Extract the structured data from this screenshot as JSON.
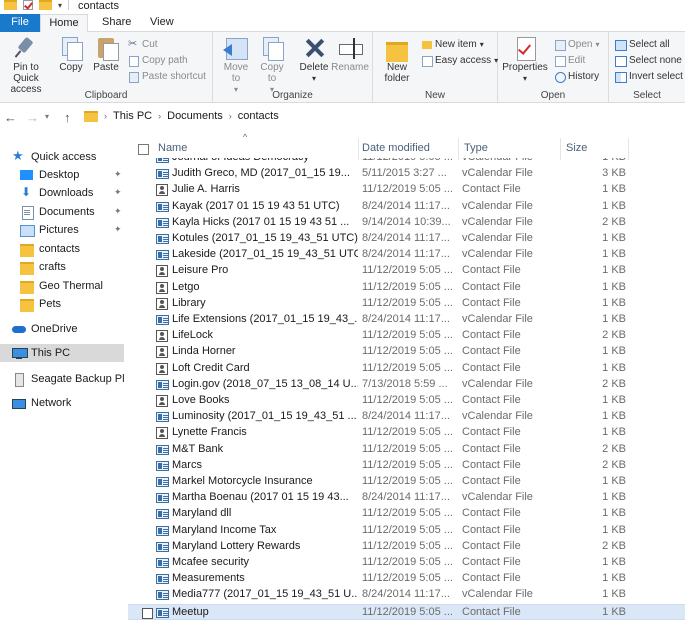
{
  "window": {
    "title": "contacts"
  },
  "tabs": {
    "file": "File",
    "home": "Home",
    "share": "Share",
    "view": "View"
  },
  "ribbon": {
    "clipboard": {
      "label": "Clipboard",
      "pin": "Pin to Quick access",
      "copy": "Copy",
      "paste": "Paste",
      "cut": "Cut",
      "copy_path": "Copy path",
      "paste_shortcut": "Paste shortcut"
    },
    "organize": {
      "label": "Organize",
      "move_to": "Move to",
      "copy_to": "Copy to",
      "delete": "Delete",
      "rename": "Rename"
    },
    "new": {
      "label": "New",
      "new_folder": "New folder",
      "new_item": "New item",
      "easy_access": "Easy access"
    },
    "open": {
      "label": "Open",
      "properties": "Properties",
      "open": "Open",
      "edit": "Edit",
      "history": "History"
    },
    "select": {
      "label": "Select",
      "select_all": "Select all",
      "select_none": "Select none",
      "invert": "Invert select"
    }
  },
  "address": {
    "crumbs": [
      "This PC",
      "Documents",
      "contacts"
    ]
  },
  "nav": {
    "items": [
      {
        "label": "Quick access",
        "icon": "star-icon",
        "pinned": false
      },
      {
        "label": "Desktop",
        "icon": "desktop-icon",
        "pinned": true
      },
      {
        "label": "Downloads",
        "icon": "download-icon",
        "pinned": true
      },
      {
        "label": "Documents",
        "icon": "documents-icon",
        "pinned": true
      },
      {
        "label": "Pictures",
        "icon": "pictures-icon",
        "pinned": true
      },
      {
        "label": "contacts",
        "icon": "folder-icon",
        "pinned": false
      },
      {
        "label": "crafts",
        "icon": "folder-icon",
        "pinned": false
      },
      {
        "label": "Geo Thermal",
        "icon": "folder-icon",
        "pinned": false
      },
      {
        "label": "Pets",
        "icon": "folder-icon",
        "pinned": false
      },
      {
        "label": "OneDrive",
        "icon": "onedrive-icon",
        "pinned": false
      },
      {
        "label": "This PC",
        "icon": "this-pc-icon",
        "pinned": false
      },
      {
        "label": "Seagate Backup Plu",
        "icon": "drive-icon",
        "pinned": false
      },
      {
        "label": "Network",
        "icon": "network-icon",
        "pinned": false
      }
    ],
    "pin_glyph": "✦"
  },
  "columns": {
    "name": "Name",
    "date": "Date modified",
    "type": "Type",
    "size": "Size"
  },
  "files": [
    {
      "name": "Journal of Ideas Democracy",
      "date": "11/12/2019 5:05 ...",
      "type": "vCalendar File",
      "size": "1 KB",
      "icon": "vcard"
    },
    {
      "name": "Judith Greco, MD (2017_01_15 19...",
      "date": "5/11/2015 3:27 ...",
      "type": "vCalendar File",
      "size": "3 KB",
      "icon": "vcard"
    },
    {
      "name": "Julie A. Harris",
      "date": "11/12/2019 5:05 ...",
      "type": "Contact File",
      "size": "1 KB",
      "icon": "contact"
    },
    {
      "name": "Kayak (2017 01 15 19 43 51 UTC)",
      "date": "8/24/2014 11:17...",
      "type": "vCalendar File",
      "size": "1 KB",
      "icon": "vcard"
    },
    {
      "name": "Kayla Hicks (2017 01 15 19 43 51 ...",
      "date": "9/14/2014 10:39...",
      "type": "vCalendar File",
      "size": "2 KB",
      "icon": "vcard"
    },
    {
      "name": "Kotules (2017_01_15 19_43_51 UTC)",
      "date": "8/24/2014 11:17...",
      "type": "vCalendar File",
      "size": "1 KB",
      "icon": "vcard"
    },
    {
      "name": "Lakeside (2017_01_15 19_43_51 UTC)",
      "date": "8/24/2014 11:17...",
      "type": "vCalendar File",
      "size": "1 KB",
      "icon": "vcard"
    },
    {
      "name": "Leisure Pro",
      "date": "11/12/2019 5:05 ...",
      "type": "Contact File",
      "size": "1 KB",
      "icon": "contact"
    },
    {
      "name": "Letgo",
      "date": "11/12/2019 5:05 ...",
      "type": "Contact File",
      "size": "1 KB",
      "icon": "contact"
    },
    {
      "name": "Library",
      "date": "11/12/2019 5:05 ...",
      "type": "Contact File",
      "size": "1 KB",
      "icon": "contact"
    },
    {
      "name": "Life Extensions (2017_01_15 19_43_...",
      "date": "8/24/2014 11:17...",
      "type": "vCalendar File",
      "size": "1 KB",
      "icon": "vcard"
    },
    {
      "name": "LifeLock",
      "date": "11/12/2019 5:05 ...",
      "type": "Contact File",
      "size": "2 KB",
      "icon": "contact"
    },
    {
      "name": "Linda Horner",
      "date": "11/12/2019 5:05 ...",
      "type": "Contact File",
      "size": "1 KB",
      "icon": "contact"
    },
    {
      "name": "Loft Credit Card",
      "date": "11/12/2019 5:05 ...",
      "type": "Contact File",
      "size": "1 KB",
      "icon": "contact"
    },
    {
      "name": "Login.gov (2018_07_15 13_08_14 U...",
      "date": "7/13/2018 5:59 ...",
      "type": "vCalendar File",
      "size": "2 KB",
      "icon": "vcard"
    },
    {
      "name": "Love Books",
      "date": "11/12/2019 5:05 ...",
      "type": "Contact File",
      "size": "1 KB",
      "icon": "contact"
    },
    {
      "name": "Luminosity (2017_01_15 19_43_51 ...",
      "date": "8/24/2014 11:17...",
      "type": "vCalendar File",
      "size": "1 KB",
      "icon": "vcard"
    },
    {
      "name": "Lynette Francis",
      "date": "11/12/2019 5:05 ...",
      "type": "Contact File",
      "size": "1 KB",
      "icon": "contact"
    },
    {
      "name": "M&T Bank",
      "date": "11/12/2019 5:05 ...",
      "type": "Contact File",
      "size": "2 KB",
      "icon": "vcard"
    },
    {
      "name": "Marcs",
      "date": "11/12/2019 5:05 ...",
      "type": "Contact File",
      "size": "2 KB",
      "icon": "vcard"
    },
    {
      "name": "Markel Motorcycle Insurance",
      "date": "11/12/2019 5:05 ...",
      "type": "Contact File",
      "size": "1 KB",
      "icon": "vcard"
    },
    {
      "name": "Martha Boenau (2017 01 15 19 43...",
      "date": "8/24/2014 11:17...",
      "type": "vCalendar File",
      "size": "1 KB",
      "icon": "vcard"
    },
    {
      "name": "Maryland dll",
      "date": "11/12/2019 5:05 ...",
      "type": "Contact File",
      "size": "1 KB",
      "icon": "vcard"
    },
    {
      "name": "Maryland Income Tax",
      "date": "11/12/2019 5:05 ...",
      "type": "Contact File",
      "size": "1 KB",
      "icon": "vcard"
    },
    {
      "name": "Maryland Lottery Rewards",
      "date": "11/12/2019 5:05 ...",
      "type": "Contact File",
      "size": "2 KB",
      "icon": "vcard"
    },
    {
      "name": "Mcafee security",
      "date": "11/12/2019 5:05 ...",
      "type": "Contact File",
      "size": "1 KB",
      "icon": "vcard"
    },
    {
      "name": "Measurements",
      "date": "11/12/2019 5:05 ...",
      "type": "Contact File",
      "size": "1 KB",
      "icon": "vcard"
    },
    {
      "name": "Media777 (2017_01_15 19_43_51 U...",
      "date": "8/24/2014 11:17...",
      "type": "vCalendar File",
      "size": "1 KB",
      "icon": "vcard"
    },
    {
      "name": "Meetup",
      "date": "11/12/2019 5:05 ...",
      "type": "Contact File",
      "size": "1 KB",
      "icon": "vcard",
      "selected": true
    },
    {
      "name": "",
      "date": "",
      "type": "",
      "size": "",
      "icon": "vcard"
    }
  ]
}
